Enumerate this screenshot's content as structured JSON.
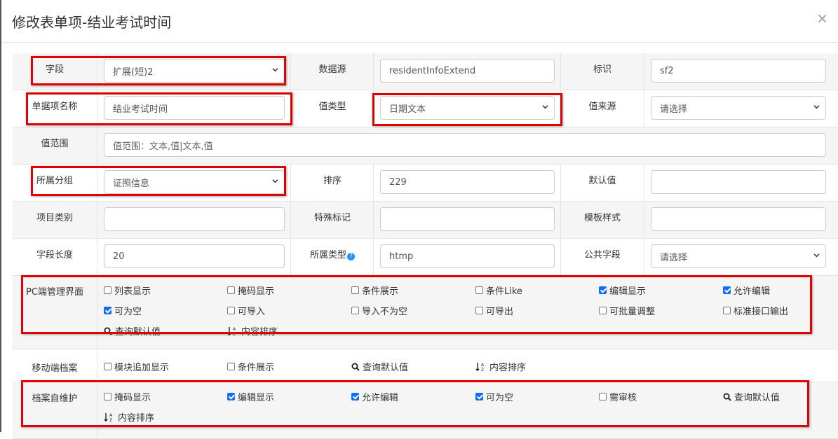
{
  "dialog": {
    "title": "修改表单项-结业考试时间",
    "close": "×"
  },
  "fields": {
    "field_label": "字段",
    "field_value": "扩展(短)2",
    "datasource_label": "数据源",
    "datasource_value": "residentInfoExtend",
    "identifier_label": "标识",
    "identifier_value": "sf2",
    "itemname_label": "单据项名称",
    "itemname_value": "结业考试时间",
    "valuetype_label": "值类型",
    "valuetype_value": "日期文本",
    "valuesource_label": "值来源",
    "valuesource_value": "请选择",
    "range_label": "值范围",
    "range_placeholder": "值范围：文本,值|文本,值",
    "group_label": "所属分组",
    "group_value": "证照信息",
    "order_label": "排序",
    "order_value": "229",
    "default_label": "默认值",
    "default_value": "",
    "category_label": "项目类别",
    "category_value": "",
    "special_label": "特殊标记",
    "special_value": "",
    "template_label": "模板样式",
    "template_value": "",
    "length_label": "字段长度",
    "length_value": "20",
    "type_label": "所属类型",
    "type_value": "htmp",
    "public_label": "公共字段",
    "public_value": "请选择"
  },
  "pc": {
    "label": "PC端管理界面",
    "options": [
      {
        "label": "列表显示",
        "checked": false
      },
      {
        "label": "掩码显示",
        "checked": false
      },
      {
        "label": "条件展示",
        "checked": false
      },
      {
        "label": "条件Like",
        "checked": false
      },
      {
        "label": "编辑显示",
        "checked": true
      },
      {
        "label": "允许编辑",
        "checked": true
      },
      {
        "label": "可为空",
        "checked": true
      },
      {
        "label": "可导入",
        "checked": false
      },
      {
        "label": "导入不为空",
        "checked": false
      },
      {
        "label": "可导出",
        "checked": false
      },
      {
        "label": "可批量调整",
        "checked": false
      },
      {
        "label": "标准接口输出",
        "checked": false
      }
    ],
    "query_default": "查询默认值",
    "sort_content": "内容排序"
  },
  "mobile": {
    "label": "移动端档案",
    "options": [
      {
        "label": "模块追加显示",
        "checked": false
      },
      {
        "label": "条件展示",
        "checked": false
      }
    ],
    "query_default": "查询默认值",
    "sort_content": "内容排序"
  },
  "self": {
    "label": "档案自维护",
    "options": [
      {
        "label": "掩码显示",
        "checked": false
      },
      {
        "label": "编辑显示",
        "checked": true
      },
      {
        "label": "允许编辑",
        "checked": true
      },
      {
        "label": "可为空",
        "checked": true
      },
      {
        "label": "需审核",
        "checked": false
      }
    ],
    "query_default": "查询默认值",
    "sort_content": "内容排序"
  },
  "icons": {
    "search": "search-icon",
    "sort": "sort-alpha-icon",
    "help": "help-icon",
    "chevron": "chevron-down-icon"
  },
  "colors": {
    "checkbox": "#0d6efd",
    "highlight": "#e00000",
    "help": "#1e90ff"
  }
}
